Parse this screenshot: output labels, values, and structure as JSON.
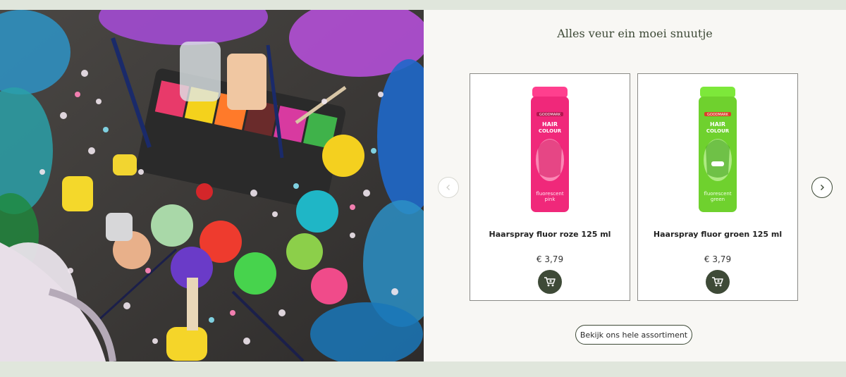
{
  "section": {
    "title": "Alles veur ein moei snuutje"
  },
  "products": [
    {
      "name": "Haarspray fluor roze 125 ml",
      "price": "€ 3,79",
      "can_color": "#f0287a",
      "can_brand": "GOODMARK",
      "can_line1": "HAIR",
      "can_line2": "COLOUR",
      "can_label1": "fluorescent",
      "can_label2": "pink"
    },
    {
      "name": "Haarspray fluor groen 125 ml",
      "price": "€ 3,79",
      "can_color": "#6fd12e",
      "can_brand": "GOODMARK",
      "can_line1": "HAIR",
      "can_line2": "COLOUR",
      "can_label1": "fluorescent",
      "can_label2": "green"
    }
  ],
  "carousel": {
    "prev_icon": "chevron-left-icon",
    "next_icon": "chevron-right-icon"
  },
  "cart_icon": "cart-icon",
  "cta": {
    "label": "Bekijk ons hele assortiment"
  },
  "colors": {
    "accent": "#3e4a37",
    "panel_bg": "#f8f7f4",
    "page_bg": "#e0e6dc"
  }
}
